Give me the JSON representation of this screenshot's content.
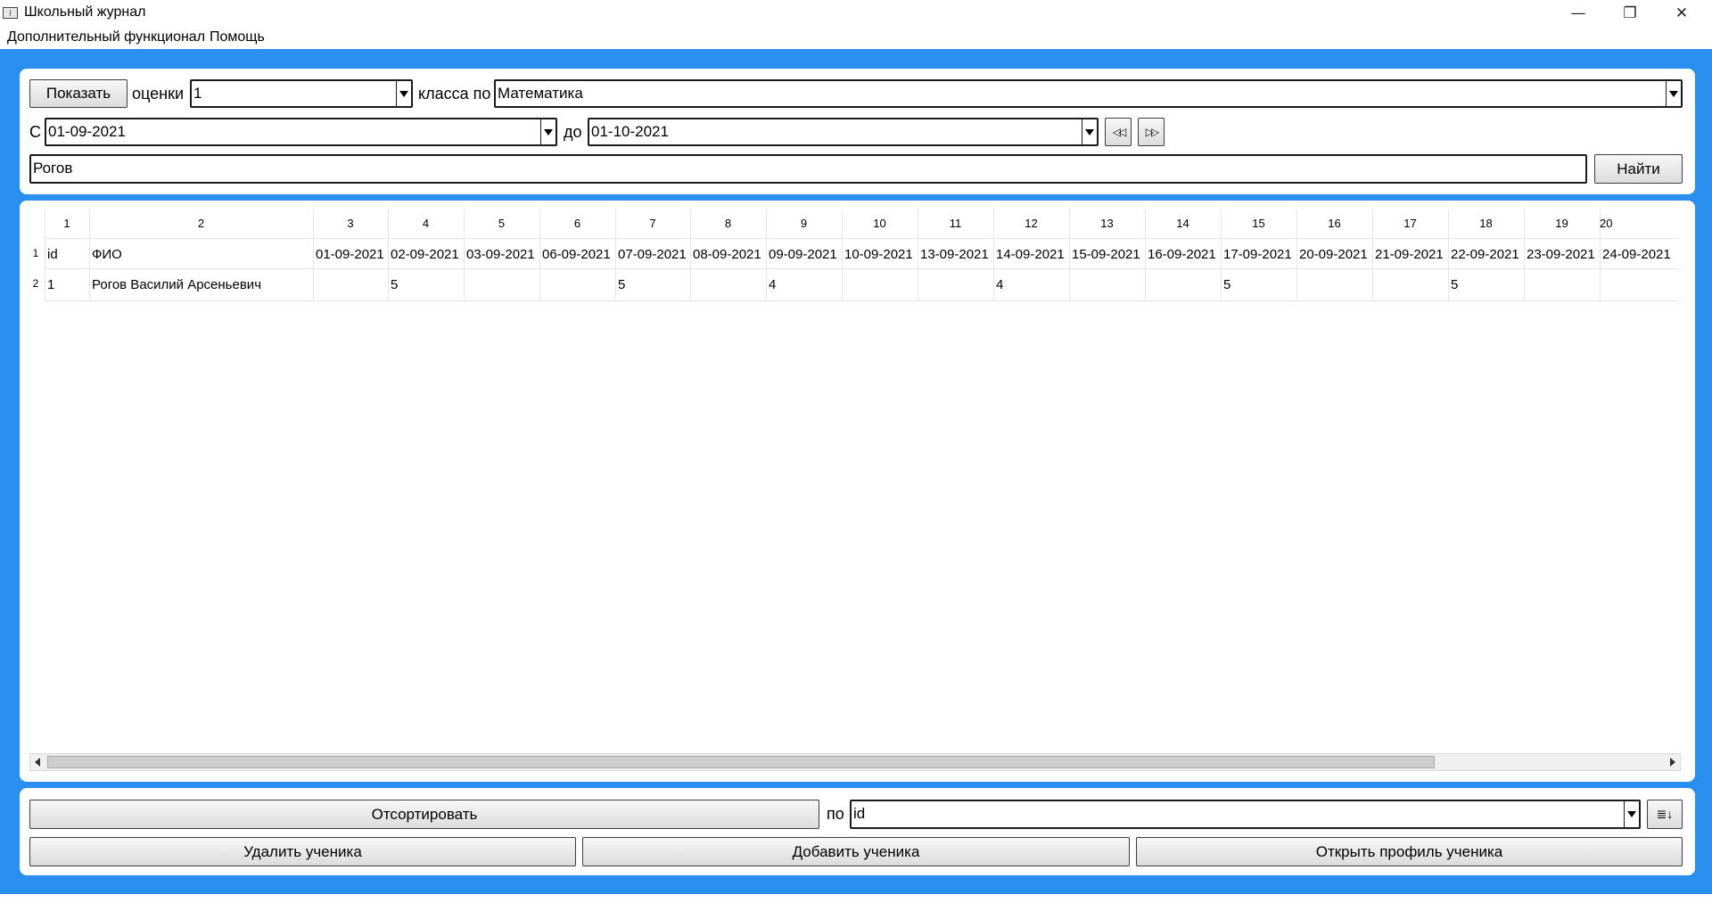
{
  "window": {
    "title": "Школьный журнал",
    "minimize": "—",
    "restore": "❐",
    "close": "✕"
  },
  "menu": [
    "Дополнительный функционал",
    "Помощь"
  ],
  "filters": {
    "show_button": "Показать",
    "grades_label": "оценки",
    "grade_value": "1",
    "class_label": "класса по",
    "subject_value": "Математика",
    "from_label": "С",
    "from_date": "01-09-2021",
    "to_label": "до",
    "to_date": "01-10-2021",
    "prev_label": "◁◁",
    "next_label": "▷▷",
    "search_value": "Рогов",
    "find_button": "Найти"
  },
  "table": {
    "column_numbers": [
      "1",
      "2",
      "3",
      "4",
      "5",
      "6",
      "7",
      "8",
      "9",
      "10",
      "11",
      "12",
      "13",
      "14",
      "15",
      "16",
      "17",
      "18",
      "19",
      "20"
    ],
    "row_numbers": [
      "1",
      "2"
    ],
    "header_row": [
      "id",
      "ФИО",
      "01-09-2021",
      "02-09-2021",
      "03-09-2021",
      "06-09-2021",
      "07-09-2021",
      "08-09-2021",
      "09-09-2021",
      "10-09-2021",
      "13-09-2021",
      "14-09-2021",
      "15-09-2021",
      "16-09-2021",
      "17-09-2021",
      "20-09-2021",
      "21-09-2021",
      "22-09-2021",
      "23-09-2021",
      "24-09-2021"
    ],
    "rows": [
      [
        "1",
        "Рогов Василий Арсеньевич",
        "",
        "5",
        "",
        "",
        "5",
        "",
        "4",
        "",
        "",
        "4",
        "",
        "",
        "5",
        "",
        "",
        "5",
        "",
        ""
      ]
    ]
  },
  "bottom": {
    "sort_button": "Отсортировать",
    "by_label": "по",
    "sort_field": "id",
    "sort_dir_label": "≣↓",
    "delete_button": "Удалить ученика",
    "add_button": "Добавить ученика",
    "profile_button": "Открыть профиль ученика"
  }
}
